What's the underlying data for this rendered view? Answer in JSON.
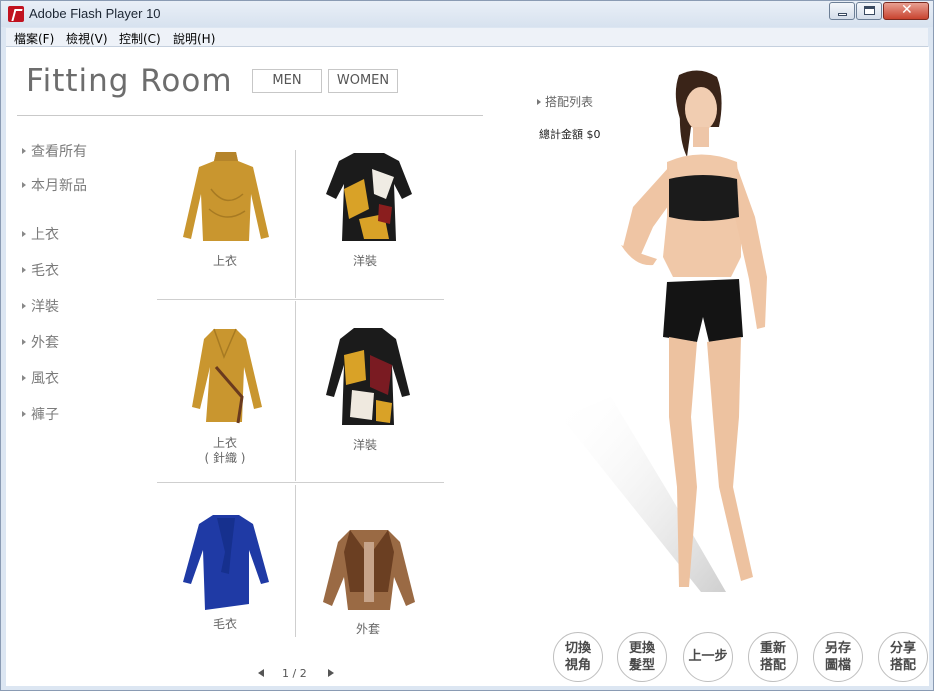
{
  "window": {
    "title": "Adobe Flash Player 10"
  },
  "menu": [
    "檔案(F)",
    "檢視(V)",
    "控制(C)",
    "說明(H)"
  ],
  "header": {
    "title": "Fitting Room",
    "men": "MEN",
    "women": "WOMEN"
  },
  "categories": [
    "查看所有",
    "本月新品",
    "上衣",
    "毛衣",
    "洋裝",
    "外套",
    "風衣",
    "褲子"
  ],
  "items": [
    {
      "label": "上衣",
      "icon": "mustard-top-icon"
    },
    {
      "label": "洋裝",
      "icon": "print-dress-icon"
    },
    {
      "label": "上衣",
      "sub": "( 針織 )",
      "icon": "knit-cardigan-icon"
    },
    {
      "label": "洋裝",
      "icon": "print-shirt-dress-icon"
    },
    {
      "label": "毛衣",
      "icon": "blue-sweater-icon"
    },
    {
      "label": "外套",
      "icon": "fur-jacket-icon"
    }
  ],
  "pager": {
    "text": "1 / 2"
  },
  "outfit": {
    "list_label": "搭配列表",
    "total_label": "總計金額",
    "total_value": "$0"
  },
  "actions": [
    {
      "line1": "切換",
      "line2": "視角"
    },
    {
      "line1": "更換",
      "line2": "髮型"
    },
    {
      "line1": "上一步",
      "line2": ""
    },
    {
      "line1": "重新",
      "line2": "搭配"
    },
    {
      "line1": "另存",
      "line2": "圖檔"
    },
    {
      "line1": "分享",
      "line2": "搭配"
    }
  ],
  "colors": {
    "mustard": "#c9962f",
    "blue": "#1f3aa5",
    "brown": "#7a4a2a",
    "black": "#1b1b1b"
  }
}
